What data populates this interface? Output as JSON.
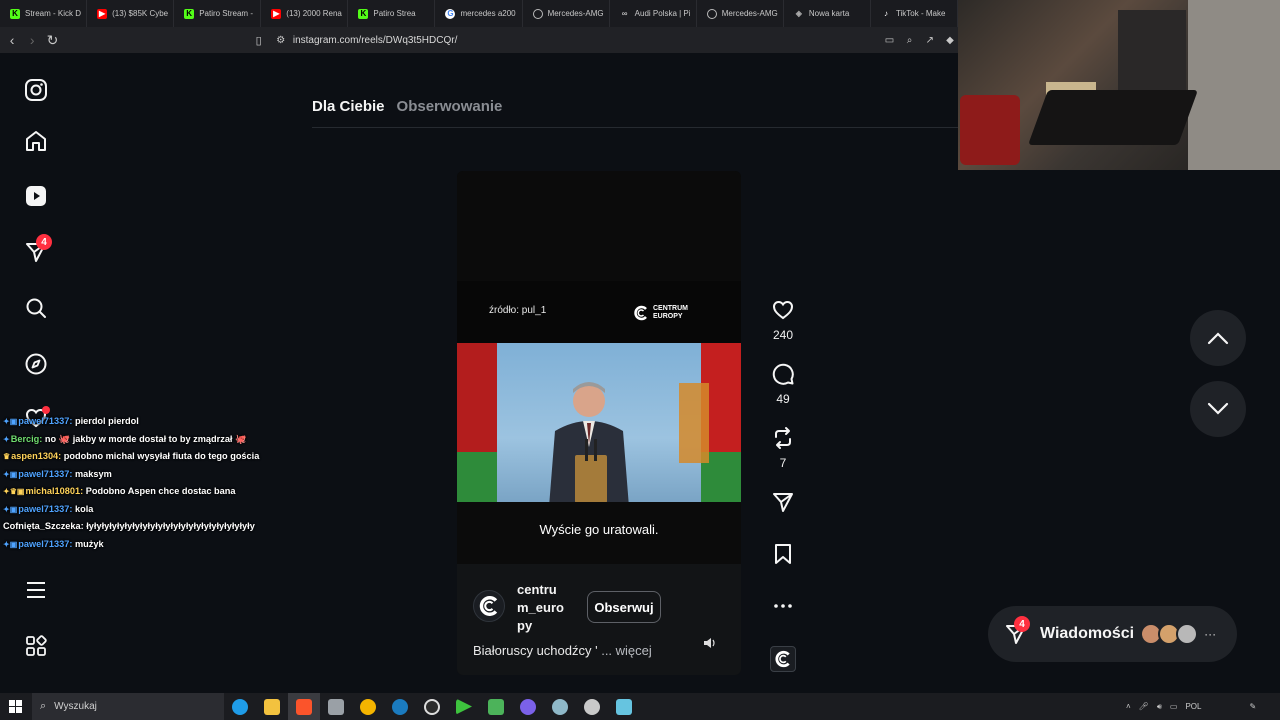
{
  "browser": {
    "tabs": [
      {
        "label": "Stream - Kick D",
        "icon": "kick-icon"
      },
      {
        "label": "(13) $85K Cybe",
        "icon": "youtube-icon"
      },
      {
        "label": "Patiro Stream -",
        "icon": "kick-icon"
      },
      {
        "label": "(13) 2000 Rena",
        "icon": "youtube-icon"
      },
      {
        "label": "Patiro Strea",
        "icon": "kick-icon"
      },
      {
        "label": "mercedes a200",
        "icon": "google-icon"
      },
      {
        "label": "Mercedes-AMG",
        "icon": "mercedes-icon"
      },
      {
        "label": "Audi Polska | Pi",
        "icon": "audi-icon"
      },
      {
        "label": "Mercedes-AMG",
        "icon": "mercedes-icon"
      },
      {
        "label": "Nowa karta",
        "icon": "new-tab-icon"
      },
      {
        "label": "TikTok - Make",
        "icon": "tiktok-icon"
      }
    ],
    "url": "instagram.com/reels/DWq3t5HDCQr/"
  },
  "sidebar": {
    "items": [
      {
        "name": "instagram-logo"
      },
      {
        "name": "home"
      },
      {
        "name": "reels"
      },
      {
        "name": "messages",
        "badge": "4"
      },
      {
        "name": "search"
      },
      {
        "name": "explore"
      },
      {
        "name": "notifications"
      },
      {
        "name": "menu"
      },
      {
        "name": "more"
      }
    ]
  },
  "feed": {
    "tab_for_you": "Dla Ciebie",
    "tab_following": "Obserwowanie"
  },
  "reel": {
    "source_text": "źródło: pul_1",
    "brand_logo_line1": "CENTRUM",
    "brand_logo_line2": "EUROPY",
    "subtitle": "Wyście go uratowali.",
    "account_name": "centru\nm_euro\npy",
    "follow_label": "Obserwuj",
    "caption": "Białoruscy uchodźcy '",
    "caption_more": " ... więcej",
    "likes": "240",
    "comments": "49",
    "reposts": "7"
  },
  "messages_pill": {
    "label": "Wiadomości",
    "badge": "4",
    "more": "···"
  },
  "chat": {
    "lines": [
      {
        "user": "pawel71337:",
        "user_color": "blue",
        "text": "pierdol pierdol"
      },
      {
        "user": "Bercig:",
        "user_color": "green",
        "text": "no 🐙 jakby w morde dostał to by zmądrzał 🐙"
      },
      {
        "user": "aspen1304:",
        "user_color": "yellow",
        "text": "podobno michal wysyłał fiuta do tego gościa"
      },
      {
        "user": "pawel71337:",
        "user_color": "blue",
        "text": "maksym"
      },
      {
        "user": "michal10801:",
        "user_color": "yellow",
        "text": "Podobno Aspen chce dostac bana"
      },
      {
        "user": "pawel71337:",
        "user_color": "blue",
        "text": "kola"
      },
      {
        "user": "Cofnięta_Szczeka:",
        "user_color": "white",
        "text": "łyłyłyłyłyłyłyłyłyłyłyłyłyłyłyłyłyłyłyłyłyły"
      },
      {
        "user": "pawel71337:",
        "user_color": "blue",
        "text": "mużyk"
      }
    ]
  },
  "taskbar": {
    "search_placeholder": "Wyszukaj",
    "tray_text": "POL"
  },
  "colors": {
    "background": "#0c0f14",
    "badge": "#ff3040",
    "panel": "#1f2227"
  }
}
